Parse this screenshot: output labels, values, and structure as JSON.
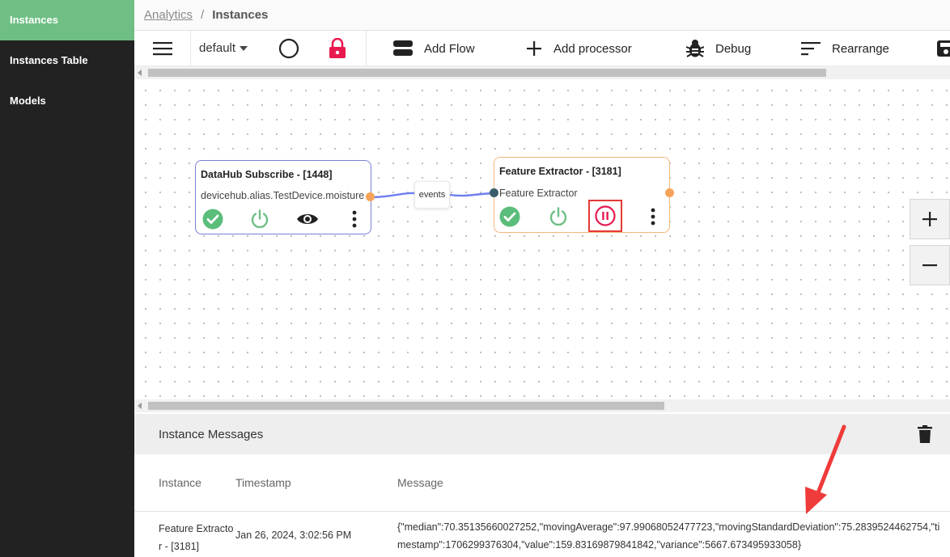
{
  "sidebar": {
    "items": [
      {
        "label": "Instances"
      },
      {
        "label": "Instances Table"
      },
      {
        "label": "Models"
      }
    ]
  },
  "breadcrumb": {
    "parent": "Analytics",
    "separator": "/",
    "current": "Instances"
  },
  "toolbar": {
    "flow_select": "default",
    "add_flow": "Add Flow",
    "add_processor": "Add processor",
    "debug": "Debug",
    "rearrange": "Rearrange"
  },
  "nodes": [
    {
      "title": "DataHub Subscribe - [1448]",
      "subtitle": "devicehub.alias.TestDevice.moisture",
      "border_color": "#7b7fd6"
    },
    {
      "title": "Feature Extractor - [3181]",
      "subtitle": "Feature Extractor",
      "border_color": "#f3b77a"
    }
  ],
  "edge": {
    "label": "events",
    "color": "#6d7ff0"
  },
  "colors": {
    "accent": "#6fbf84",
    "status_ok": "#5bbd7a",
    "danger": "#e8194f",
    "highlight": "#e53935",
    "port_out": "#f5a35a",
    "port_in": "#3a5d6b"
  },
  "messages": {
    "title": "Instance Messages",
    "columns": [
      "Instance",
      "Timestamp",
      "Message"
    ],
    "rows": [
      {
        "instance": "Feature Extractor - [3181]",
        "timestamp": "Jan 26, 2024, 3:02:56 PM",
        "message": "{\"median\":70.35135660027252,\"movingAverage\":97.99068052477723,\"movingStandardDeviation\":75.2839524462754,\"timestamp\":1706299376304,\"value\":159.83169879841842,\"variance\":5667.673495933058}"
      }
    ]
  }
}
